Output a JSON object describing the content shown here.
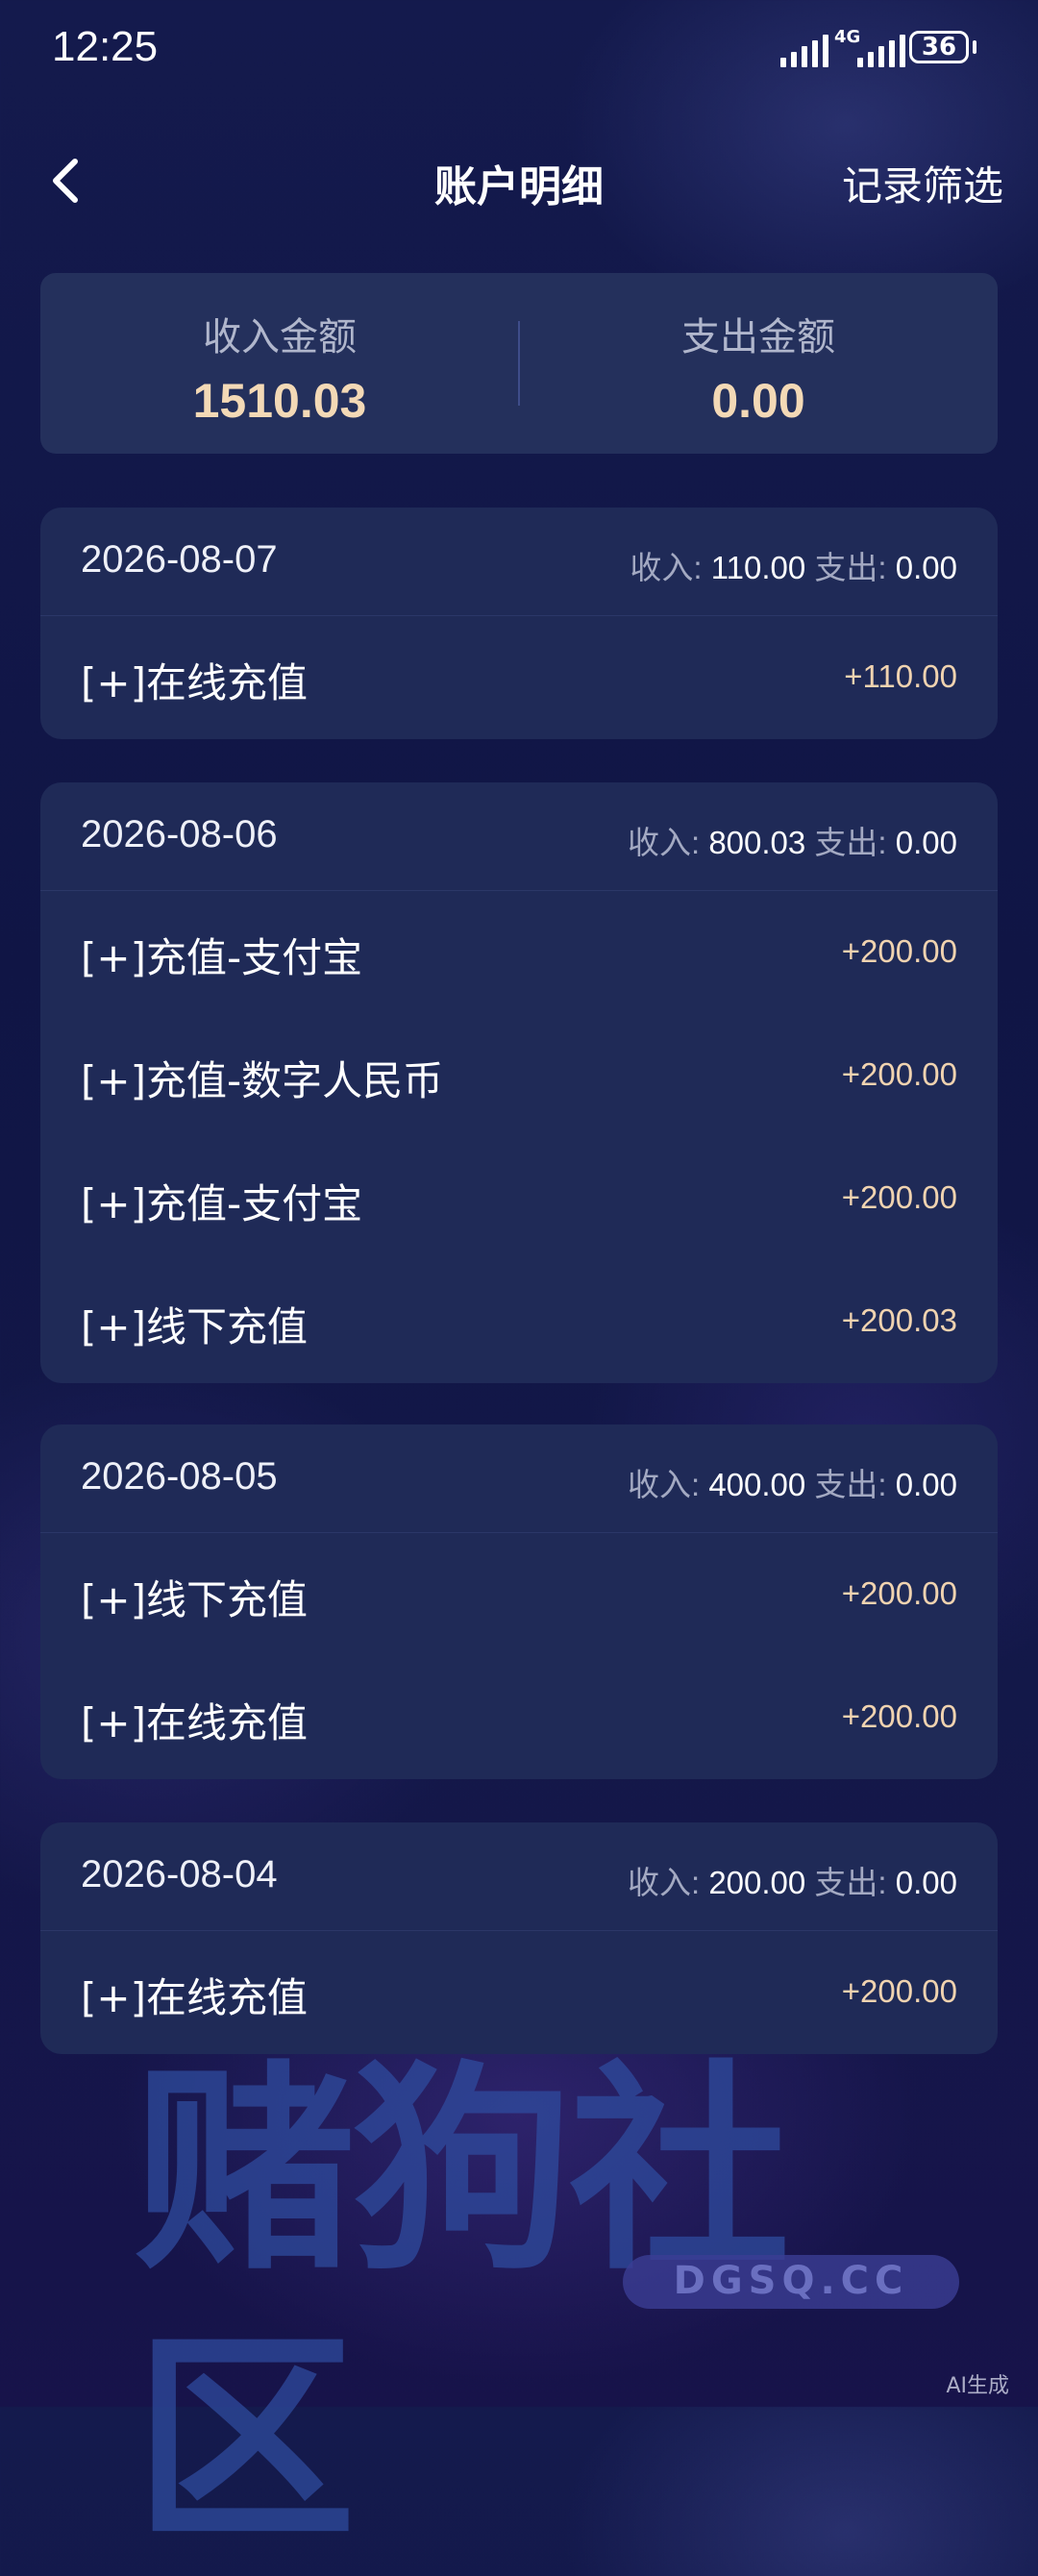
{
  "status_bar": {
    "time": "12:25",
    "network": "4G",
    "battery": "36"
  },
  "nav": {
    "title": "账户明细",
    "filter_label": "记录筛选"
  },
  "summary": {
    "income_label": "收入金额",
    "income_value": "1510.03",
    "expense_label": "支出金额",
    "expense_value": "0.00"
  },
  "labels": {
    "income": "收入:",
    "expense": "支出:"
  },
  "groups": [
    {
      "date": "2026-08-07",
      "income": "110.00",
      "expense": "0.00",
      "items": [
        {
          "label": "[+]在线充值",
          "amount": "+110.00"
        }
      ]
    },
    {
      "date": "2026-08-06",
      "income": "800.03",
      "expense": "0.00",
      "items": [
        {
          "label": "[+]充值-支付宝",
          "amount": "+200.00"
        },
        {
          "label": "[+]充值-数字人民币",
          "amount": "+200.00"
        },
        {
          "label": "[+]充值-支付宝",
          "amount": "+200.00"
        },
        {
          "label": "[+]线下充值",
          "amount": "+200.03"
        }
      ]
    },
    {
      "date": "2026-08-05",
      "income": "400.00",
      "expense": "0.00",
      "items": [
        {
          "label": "[+]线下充值",
          "amount": "+200.00"
        },
        {
          "label": "[+]在线充值",
          "amount": "+200.00"
        }
      ]
    },
    {
      "date": "2026-08-04",
      "income": "200.00",
      "expense": "0.00",
      "items": [
        {
          "label": "[+]在线充值",
          "amount": "+200.00"
        }
      ]
    }
  ],
  "watermark": {
    "text": "赌狗社区",
    "url": "DGSQ.CC"
  },
  "ai_badge": "AI生成"
}
